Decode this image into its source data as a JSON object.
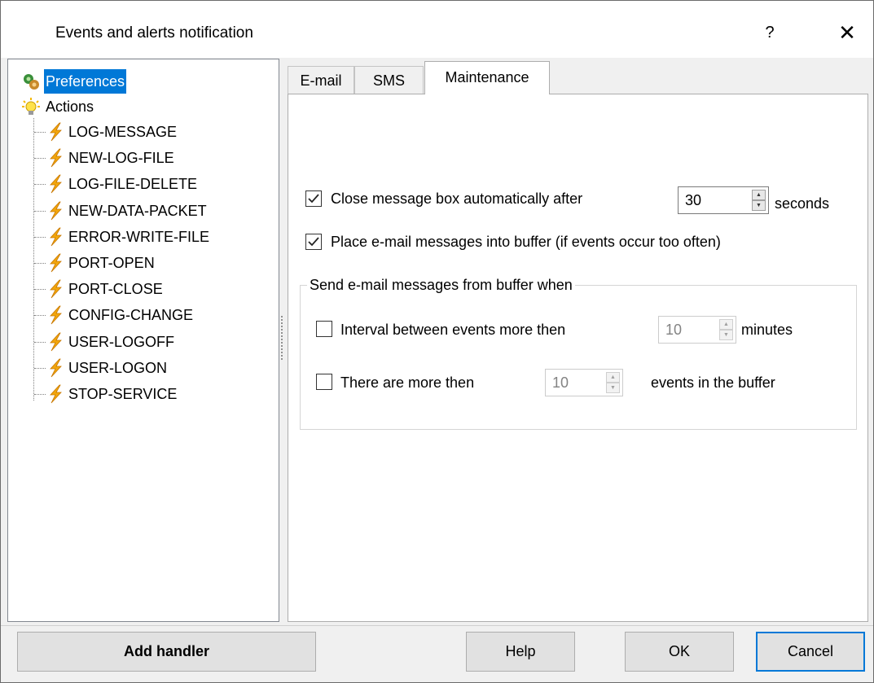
{
  "window": {
    "title": "Events and alerts notification",
    "help_glyph": "?",
    "close_glyph": "✕"
  },
  "tree": {
    "root_items": [
      {
        "label": "Preferences",
        "icon": "preferences-icon",
        "selected": true
      },
      {
        "label": "Actions",
        "icon": "lightbulb-icon",
        "selected": false
      }
    ],
    "actions": [
      "LOG-MESSAGE",
      "NEW-LOG-FILE",
      "LOG-FILE-DELETE",
      "NEW-DATA-PACKET",
      "ERROR-WRITE-FILE",
      "PORT-OPEN",
      "PORT-CLOSE",
      "CONFIG-CHANGE",
      "USER-LOGOFF",
      "USER-LOGON",
      "STOP-SERVICE"
    ],
    "action_icon": "lightning-icon"
  },
  "tabs": [
    {
      "label": "E-mail",
      "active": false
    },
    {
      "label": "SMS",
      "active": false
    },
    {
      "label": "Maintenance",
      "active": true
    }
  ],
  "maintenance": {
    "close_box": {
      "label": "Close message box automatically after",
      "checked": true,
      "value": "30",
      "unit": "seconds"
    },
    "buffer": {
      "label": "Place e-mail messages into buffer (if events occur too often)",
      "checked": true
    },
    "group": {
      "title": "Send e-mail messages from buffer when",
      "interval": {
        "label": "Interval between events more then",
        "checked": false,
        "value": "10",
        "unit": "minutes"
      },
      "count": {
        "label": "There are more then",
        "checked": false,
        "value": "10",
        "unit": "events in the buffer"
      }
    }
  },
  "buttons": {
    "add_handler": "Add handler",
    "help": "Help",
    "ok": "OK",
    "cancel": "Cancel"
  },
  "colors": {
    "selection": "#0078d7",
    "lightning": "#f2a60c"
  }
}
